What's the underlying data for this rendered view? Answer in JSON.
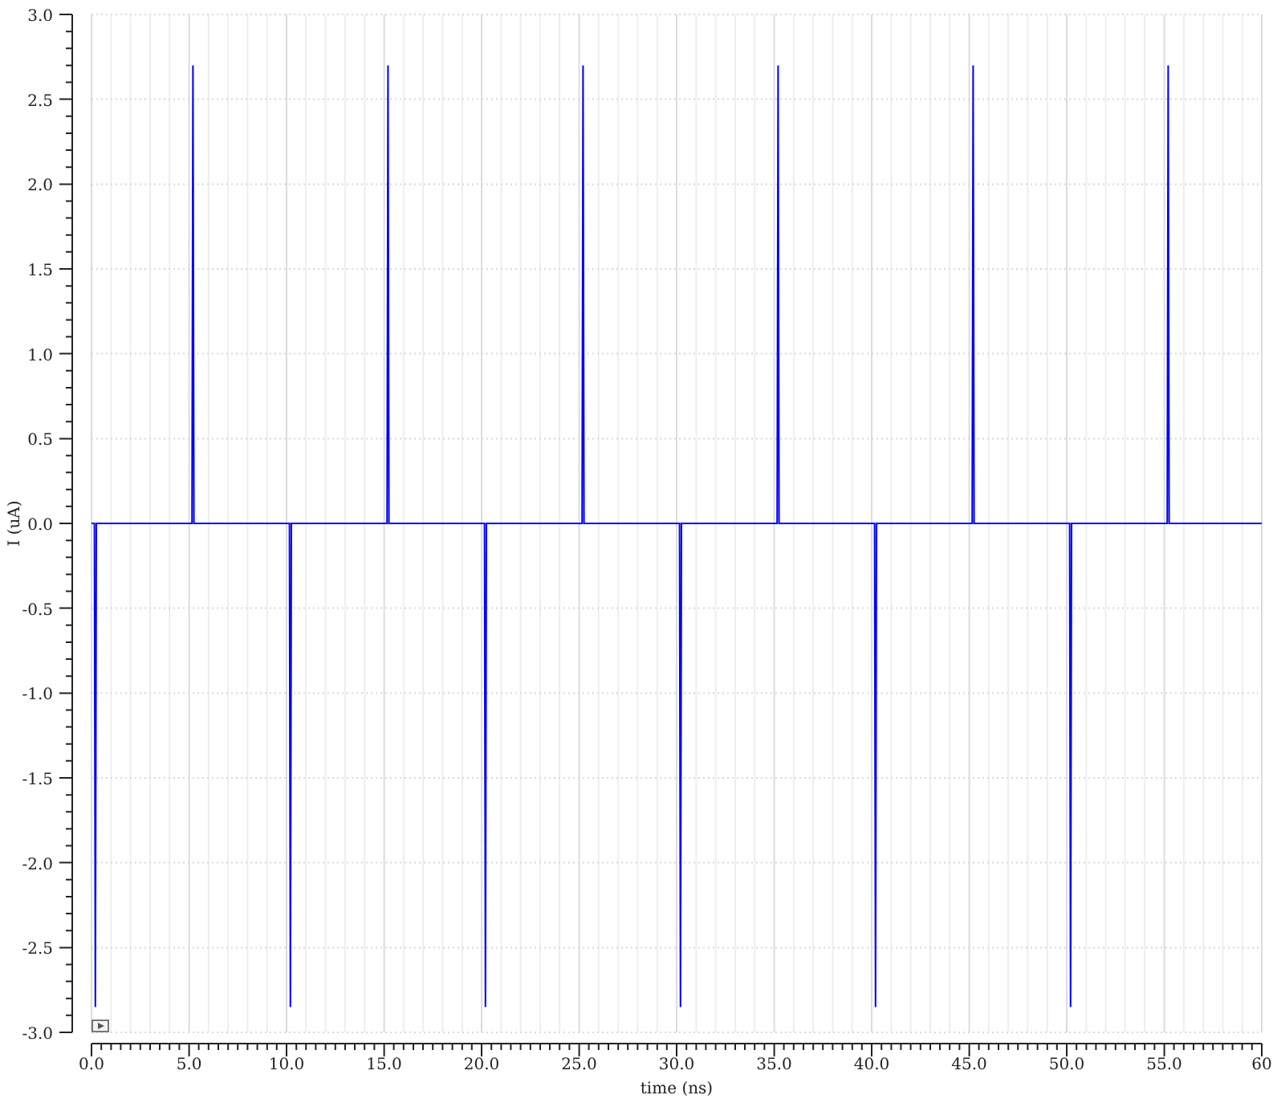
{
  "chart_data": {
    "type": "line",
    "grid": true,
    "xlabel": "time (ns)",
    "ylabel": "I (uA)",
    "x": [
      0,
      0.15,
      0.2,
      0.25,
      5.15,
      5.2,
      5.25,
      10.15,
      10.2,
      10.25,
      15.15,
      15.2,
      15.25,
      20.15,
      20.2,
      20.25,
      25.15,
      25.2,
      25.25,
      30.15,
      30.2,
      30.25,
      35.15,
      35.2,
      35.25,
      40.15,
      40.2,
      40.25,
      45.15,
      45.2,
      45.25,
      50.15,
      50.2,
      50.25,
      55.15,
      55.2,
      55.25,
      60
    ],
    "series": [
      {
        "color": "#0000ff",
        "values": [
          0,
          0,
          -2.85,
          0,
          0,
          2.7,
          0,
          0,
          -2.85,
          0,
          0,
          2.7,
          0,
          0,
          -2.85,
          0,
          0,
          2.7,
          0,
          0,
          -2.85,
          0,
          0,
          2.7,
          0,
          0,
          -2.85,
          0,
          0,
          2.7,
          0,
          0,
          -2.85,
          0,
          0,
          2.7,
          0,
          0
        ]
      }
    ],
    "xlim": [
      0,
      60
    ],
    "ylim": [
      -3,
      3
    ],
    "xticks": [
      {
        "value": 0,
        "label": "0.0"
      },
      {
        "value": 5,
        "label": "5.0"
      },
      {
        "value": 10,
        "label": "10.0"
      },
      {
        "value": 15,
        "label": "15.0"
      },
      {
        "value": 20,
        "label": "20.0"
      },
      {
        "value": 25,
        "label": "25.0"
      },
      {
        "value": 30,
        "label": "30.0"
      },
      {
        "value": 35,
        "label": "35.0"
      },
      {
        "value": 40,
        "label": "40.0"
      },
      {
        "value": 45,
        "label": "45.0"
      },
      {
        "value": 50,
        "label": "50.0"
      },
      {
        "value": 55,
        "label": "55.0"
      },
      {
        "value": 60,
        "label": "60"
      }
    ],
    "yticks": [
      {
        "value": 3,
        "label": "3.0"
      },
      {
        "value": 2.5,
        "label": "2.5"
      },
      {
        "value": 2,
        "label": "2.0"
      },
      {
        "value": 1.5,
        "label": "1.5"
      },
      {
        "value": 1,
        "label": "1.0"
      },
      {
        "value": 0.5,
        "label": "0.5"
      },
      {
        "value": 0,
        "label": "0.0"
      },
      {
        "value": -0.5,
        "label": "-0.5"
      },
      {
        "value": -1,
        "label": "-1.0"
      },
      {
        "value": -1.5,
        "label": "-1.5"
      },
      {
        "value": -2,
        "label": "-2.0"
      },
      {
        "value": -2.5,
        "label": "-2.5"
      },
      {
        "value": -3,
        "label": "-3.0"
      }
    ]
  }
}
